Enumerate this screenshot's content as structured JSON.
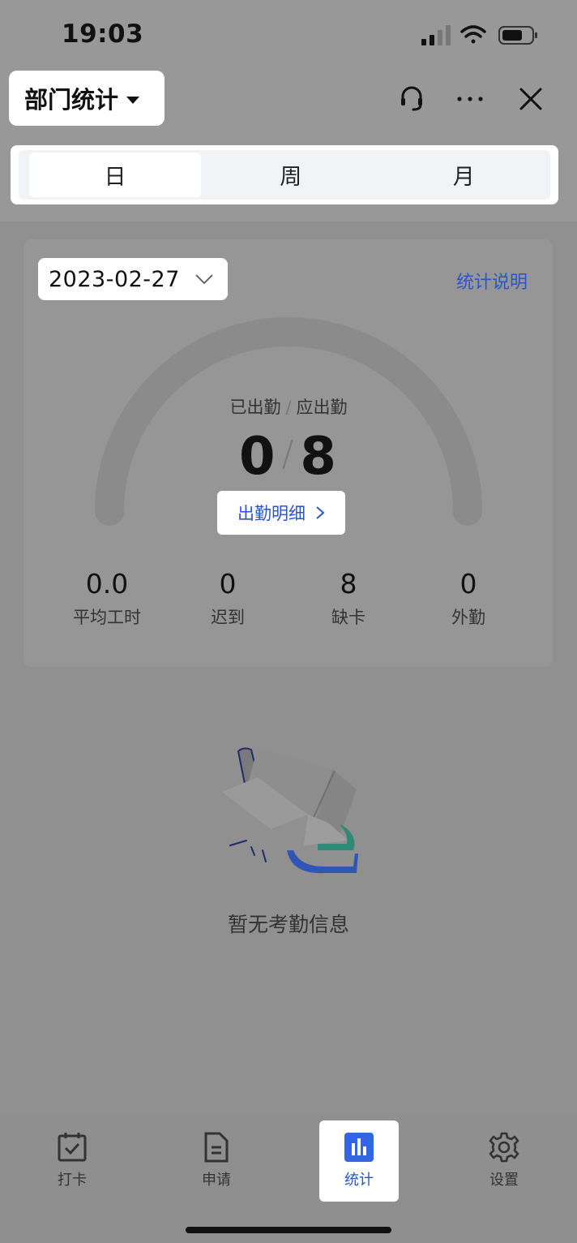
{
  "status": {
    "time": "19:03"
  },
  "header": {
    "title": "部门统计"
  },
  "segment": {
    "tabs": [
      "日",
      "周",
      "月"
    ],
    "active": 0
  },
  "card": {
    "date": "2023-02-27",
    "explain_link": "统计说明",
    "gauge": {
      "label_present": "已出勤",
      "label_separator": "/",
      "label_expected": "应出勤",
      "present": "0",
      "expected": "8",
      "value_separator": "/"
    },
    "detail_button": "出勤明细",
    "stats": [
      {
        "value": "0.0",
        "label": "平均工时"
      },
      {
        "value": "0",
        "label": "迟到"
      },
      {
        "value": "8",
        "label": "缺卡"
      },
      {
        "value": "0",
        "label": "外勤"
      }
    ]
  },
  "empty": {
    "text": "暂无考勤信息"
  },
  "tabbar": {
    "items": [
      {
        "label": "打卡",
        "icon": "calendar-check-icon"
      },
      {
        "label": "申请",
        "icon": "document-icon"
      },
      {
        "label": "统计",
        "icon": "bar-chart-icon"
      },
      {
        "label": "设置",
        "icon": "gear-icon"
      }
    ],
    "active": 2
  }
}
